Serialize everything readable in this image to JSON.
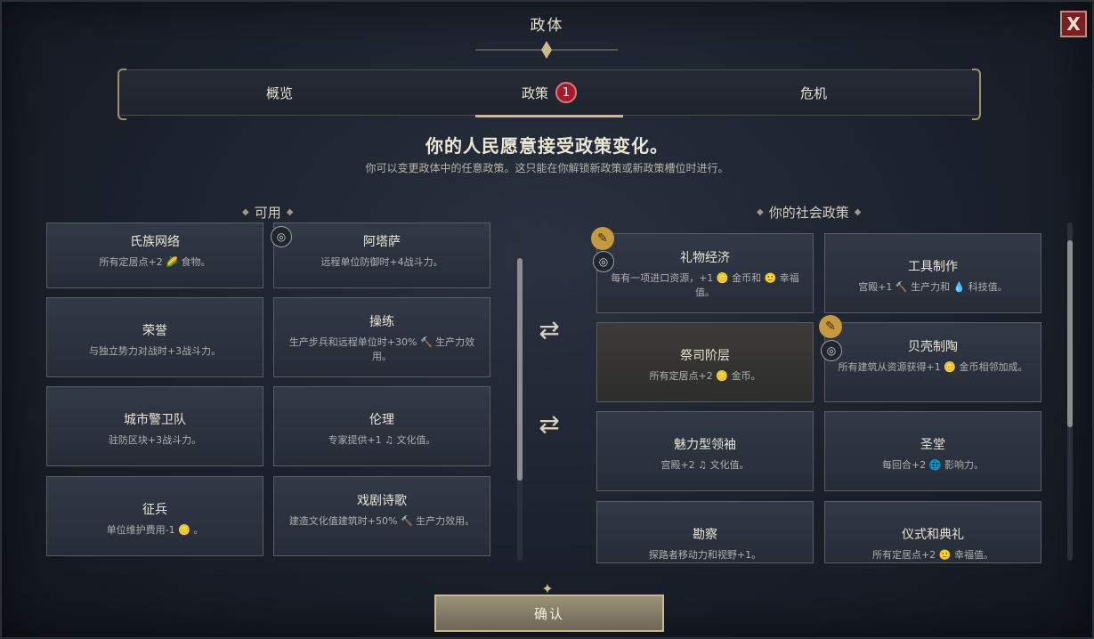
{
  "title": "政体",
  "close_label": "X",
  "tabs": [
    {
      "label": "概览"
    },
    {
      "label": "政策",
      "badge": "1"
    },
    {
      "label": "危机"
    }
  ],
  "headline": "你的人民愿意接受政策变化。",
  "subline": "你可以变更政体中的任意政策。这只能在你解锁新政策或新政策槽位时进行。",
  "available": {
    "label": "可用",
    "cards": [
      {
        "name": "氏族网络",
        "desc": "所有定居点+2 🌽 食物。"
      },
      {
        "name": "阿塔萨",
        "desc": "远程单位防御时+4战斗力。"
      },
      {
        "name": "荣誉",
        "desc": "与独立势力对战时+3战斗力。"
      },
      {
        "name": "操练",
        "desc": "生产步兵和远程单位时+30% 🔨 生产力效用。"
      },
      {
        "name": "城市警卫队",
        "desc": "驻防区块+3战斗力。"
      },
      {
        "name": "伦理",
        "desc": "专家提供+1 ♫ 文化值。"
      },
      {
        "name": "征兵",
        "desc": "单位维护费用-1 🪙 。"
      },
      {
        "name": "戏剧诗歌",
        "desc": "建造文化值建筑时+50% 🔨 生产力效用。"
      }
    ]
  },
  "social": {
    "label": "你的社会政策",
    "cards": [
      {
        "name": "礼物经济",
        "desc": "每有一项进口资源，+1 🪙 金币和 🙂 幸福值。"
      },
      {
        "name": "工具制作",
        "desc": "宫殿+1 🔨 生产力和 💧 科技值。"
      },
      {
        "name": "祭司阶层",
        "desc": "所有定居点+2 🪙 金币。"
      },
      {
        "name": "贝壳制陶",
        "desc": "所有建筑从资源获得+1 🪙 金币相邻加成。"
      },
      {
        "name": "魅力型领袖",
        "desc": "宫殿+2 ♫ 文化值。"
      },
      {
        "name": "圣堂",
        "desc": "每回合+2 🌐 影响力。"
      },
      {
        "name": "勘察",
        "desc": "探路者移动力和视野+1。"
      },
      {
        "name": "仪式和典礼",
        "desc": "所有定居点+2 🙂 幸福值。"
      }
    ]
  },
  "confirm_label": "确认"
}
